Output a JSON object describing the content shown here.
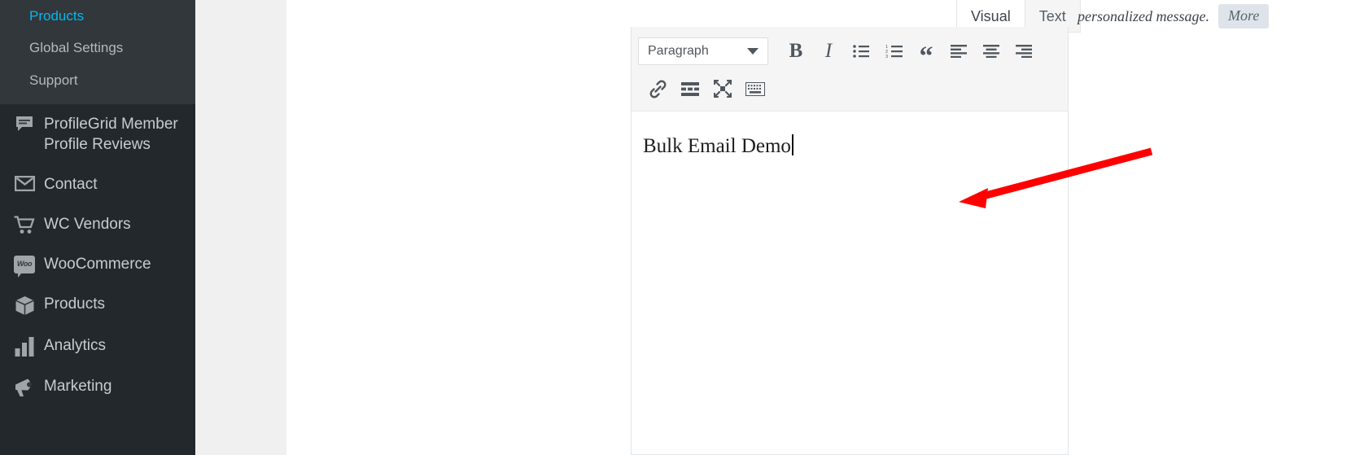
{
  "sidebar": {
    "submenu": [
      {
        "label": "Products",
        "name": "sidebar-subitem-products"
      },
      {
        "label": "Global Settings",
        "name": "sidebar-subitem-global-settings"
      },
      {
        "label": "Support",
        "name": "sidebar-subitem-support"
      }
    ],
    "items": [
      {
        "label": "ProfileGrid Member Profile Reviews",
        "icon": "comment-icon"
      },
      {
        "label": "Contact",
        "icon": "envelope-icon"
      },
      {
        "label": "WC Vendors",
        "icon": "cart-icon"
      },
      {
        "label": "WooCommerce",
        "icon": "woo-icon"
      },
      {
        "label": "Products",
        "icon": "box-icon"
      },
      {
        "label": "Analytics",
        "icon": "bar-chart-icon"
      },
      {
        "label": "Marketing",
        "icon": "megaphone-icon"
      }
    ],
    "bg_color": "#23282d",
    "submenu_bg_color": "#32373c"
  },
  "editor": {
    "format_select": {
      "value": "Paragraph"
    },
    "toolbar_row1": [
      {
        "label": "B",
        "name": "bold-icon",
        "title": "Bold"
      },
      {
        "label": "I",
        "name": "italic-icon",
        "title": "Italic"
      },
      {
        "label": "",
        "name": "bulleted-list-icon",
        "title": "Bulleted list"
      },
      {
        "label": "",
        "name": "numbered-list-icon",
        "title": "Numbered list"
      },
      {
        "label": "“",
        "name": "blockquote-icon",
        "title": "Blockquote"
      },
      {
        "label": "",
        "name": "align-left-icon",
        "title": "Align left"
      },
      {
        "label": "",
        "name": "align-center-icon",
        "title": "Align center"
      },
      {
        "label": "",
        "name": "align-right-icon",
        "title": "Align right"
      }
    ],
    "toolbar_row2": [
      {
        "name": "link-icon",
        "title": "Insert/edit link"
      },
      {
        "name": "read-more-icon",
        "title": "Insert Read More tag"
      },
      {
        "name": "fullscreen-icon",
        "title": "Distraction-free writing mode"
      },
      {
        "name": "keyboard-shortcuts-icon",
        "title": "Keyboard shortcuts"
      }
    ],
    "content": "Bulk Email Demo"
  },
  "tabs": [
    {
      "label": "Visual",
      "active": true
    },
    {
      "label": "Text",
      "active": false
    }
  ],
  "top_note": {
    "text": "personalized message.",
    "more_label": "More"
  },
  "annotation": {
    "arrow_color": "#ff0000"
  }
}
